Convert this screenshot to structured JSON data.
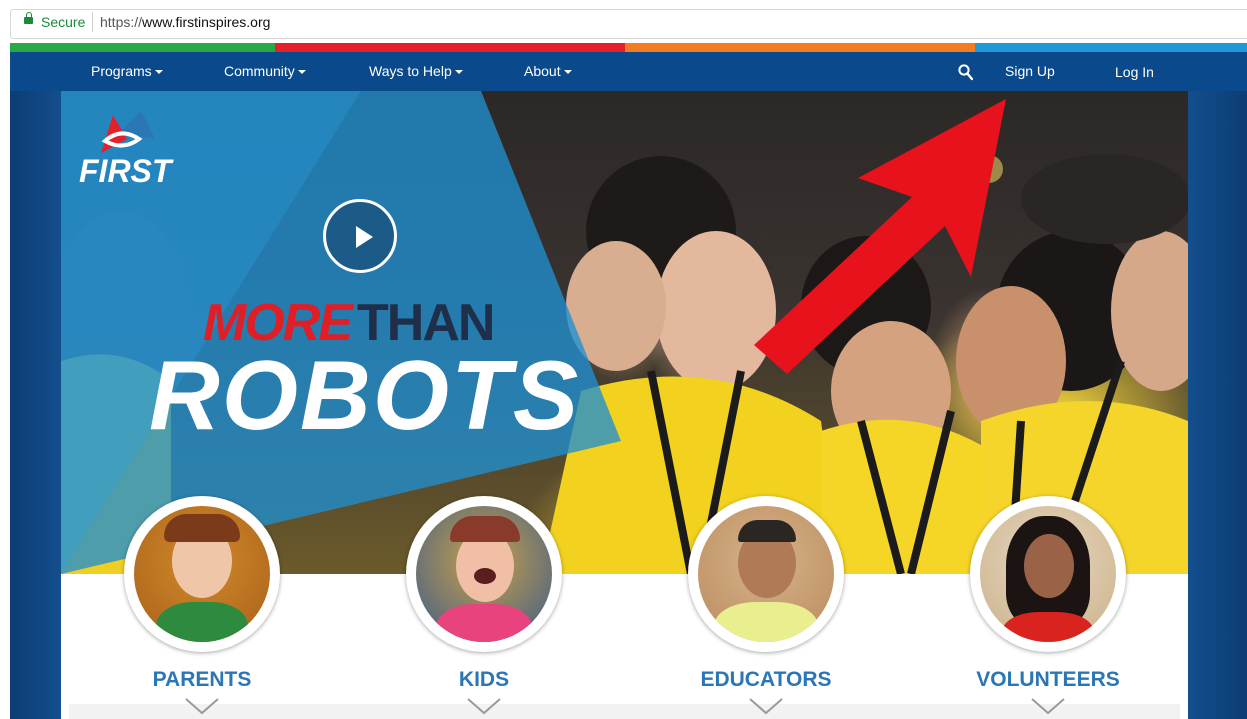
{
  "browser": {
    "secure_label": "Secure",
    "url_scheme": "https://",
    "url_host": "www.firstinspires.org"
  },
  "color_strip": [
    "#29a84a",
    "#e4202a",
    "#f47b20",
    "#1e9ad6"
  ],
  "nav": {
    "items": [
      {
        "label": "Programs",
        "icon": "chevron-down-icon"
      },
      {
        "label": "Community",
        "icon": "chevron-down-icon"
      },
      {
        "label": "Ways to Help",
        "icon": "chevron-down-icon"
      },
      {
        "label": "About",
        "icon": "chevron-down-icon"
      }
    ],
    "search_icon": "search-icon",
    "sign_up": "Sign Up",
    "log_in": "Log In",
    "background": "#0a4a8c"
  },
  "hero": {
    "logo_text": "FIRST",
    "headline_part1": "MORE",
    "headline_part2": "THAN",
    "headline_big": "ROBOTS",
    "play_icon": "play-icon",
    "arrow_color": "#e8121c"
  },
  "audiences": [
    {
      "label": "PARENTS"
    },
    {
      "label": "KIDS"
    },
    {
      "label": "EDUCATORS"
    },
    {
      "label": "VOLUNTEERS"
    }
  ],
  "accent": "#2a76b7"
}
